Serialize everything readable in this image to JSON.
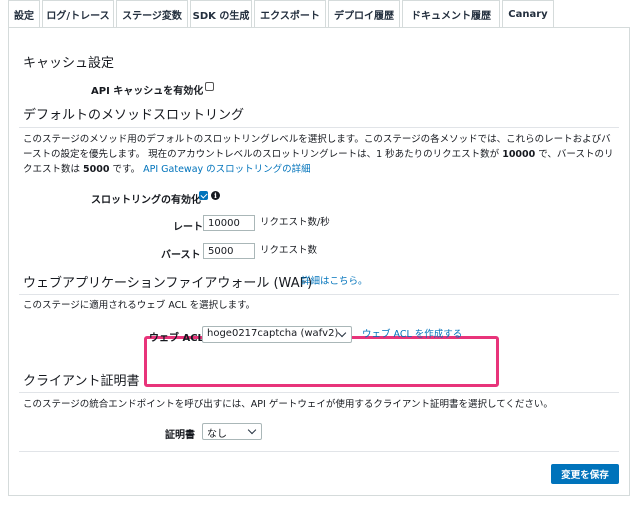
{
  "tabs": [
    {
      "label": "設定",
      "active": true
    },
    {
      "label": "ログ/トレース"
    },
    {
      "label": "ステージ変数"
    },
    {
      "label": "SDK の生成"
    },
    {
      "label": "エクスポート"
    },
    {
      "label": "デプロイ履歴"
    },
    {
      "label": "ドキュメント履歴"
    },
    {
      "label": "Canary"
    }
  ],
  "cache": {
    "title": "キャッシュ設定",
    "enable_label": "API キャッシュを有効化",
    "enabled": false
  },
  "throttling": {
    "title": "デフォルトのメソッドスロットリング",
    "desc_line1": "このステージのメソッド用のデフォルトのスロットリングレベルを選択します。このステージの各メソッドでは、これらのレートおよびバ",
    "desc_line2": "ーストの設定を優先します。 現在のアカウントレベルのスロットリングレートは、1 秒あたりのリクエスト数が",
    "desc_rate": "10000",
    "desc_line2b": "で、バーストのリ",
    "desc_line3a": "クエスト数は",
    "desc_burst": "5000",
    "desc_line3b": "です。",
    "desc_link": "API Gateway のスロットリングの詳細",
    "enable_label": "スロットリングの有効化",
    "enabled": true,
    "rate_label": "レート",
    "rate_value": "10000",
    "rate_unit": "リクエスト数/秒",
    "burst_label": "バースト",
    "burst_value": "5000",
    "burst_unit": "リクエスト数"
  },
  "waf": {
    "title": "ウェブアプリケーションファイアウォール (WAF)",
    "details_link": "詳細はこちら。",
    "desc": "このステージに適用されるウェブ ACL を選択します。",
    "acl_label": "ウェブ ACL",
    "acl_selected": "hoge0217captcha (wafv2)",
    "create_link": "ウェブ ACL を作成する",
    "highlight_color": "#e8347a"
  },
  "cert": {
    "title": "クライアント証明書",
    "desc": "このステージの統合エンドポイントを呼び出すには、API ゲートウェイが使用するクライアント証明書を選択してください。",
    "label": "証明書",
    "selected": "なし"
  },
  "save_button": "変更を保存",
  "colors": {
    "link": "#0073bb",
    "primary_button": "#0073bb",
    "border": "#d5dbdb"
  }
}
